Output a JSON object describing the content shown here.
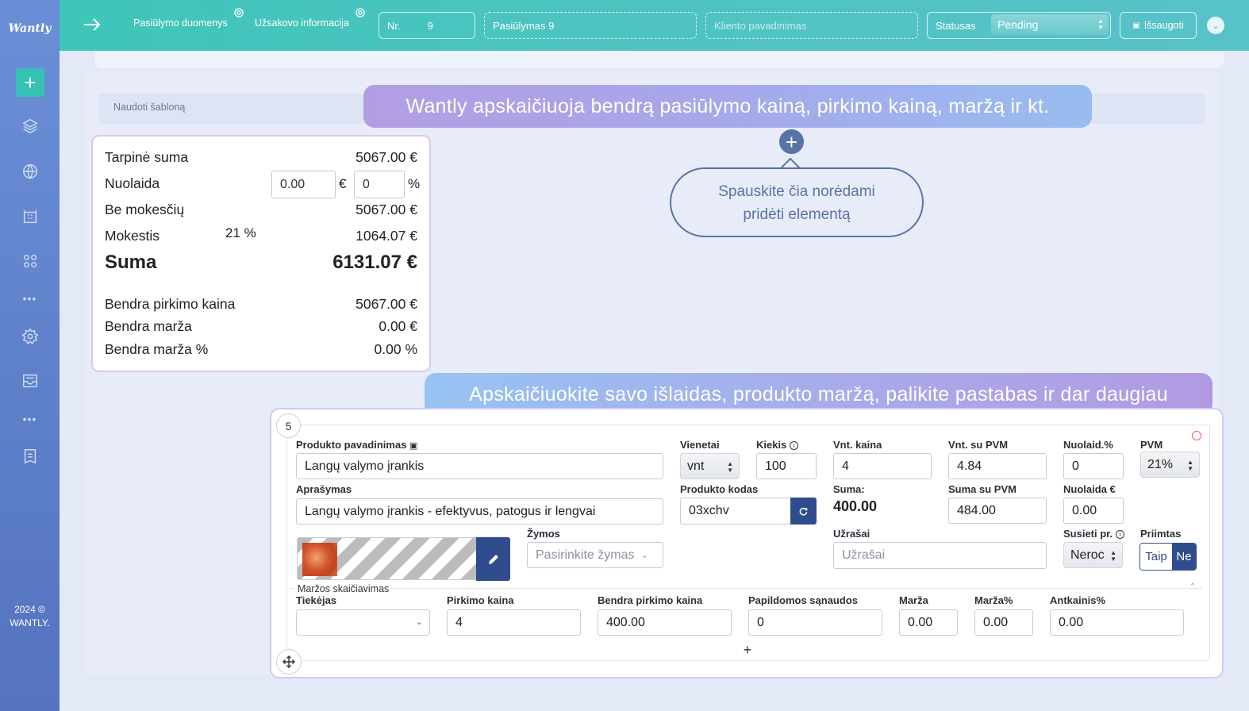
{
  "app": {
    "logo": "Wantly",
    "footer_year": "2024 ©",
    "footer_brand": "WANTLY."
  },
  "topbar": {
    "tab_offer_data": "Pasiūlymo duomenys",
    "tab_client_info": "Užsakovo informacija",
    "nr_label": "Nr.",
    "nr_value": "9",
    "offer_title": "Pasiūlymas 9",
    "client_placeholder": "Kliento pavadinimas",
    "status_label": "Statusas",
    "status_value": "Pending",
    "save_label": "Išsaugoti"
  },
  "main": {
    "use_template": "Naudoti šabloną",
    "callout_top": "Wantly apskaičiuoja bendrą pasiūlymo kainą, pirkimo kainą, maržą ir kt.",
    "callout_bottom": "Apskaičiuokite savo išlaidas, produkto maržą, palikite pastabas ir dar daugiau",
    "add_hint_line1": "Spauskite čia norėdami",
    "add_hint_line2": "pridėti elementą"
  },
  "totals": {
    "subtotal_label": "Tarpinė suma",
    "subtotal_value": "5067.00 €",
    "discount_label": "Nuolaida",
    "discount_amount": "0.00",
    "discount_currency": "€",
    "discount_percent": "0",
    "discount_percent_unit": "%",
    "no_tax_label": "Be mokesčių",
    "no_tax_value": "5067.00 €",
    "tax_label": "Mokestis",
    "tax_rate": "21 %",
    "tax_value": "1064.07 €",
    "total_label": "Suma",
    "total_value": "6131.07 €",
    "purchase_label": "Bendra pirkimo kaina",
    "purchase_value": "5067.00 €",
    "margin_label": "Bendra marža",
    "margin_value": "0.00 €",
    "margin_pct_label": "Bendra marža %",
    "margin_pct_value": "0.00 %"
  },
  "item": {
    "index": "5",
    "name_label": "Produkto pavadinimas",
    "name_value": "Langų valymo įrankis",
    "units_label": "Vienetai",
    "units_value": "vnt",
    "qty_label": "Kiekis",
    "qty_value": "100",
    "unit_price_label": "Vnt. kaina",
    "unit_price_value": "4",
    "unit_vat_label": "Vnt. su PVM",
    "unit_vat_value": "4.84",
    "discount_pct_label": "Nuolaid.%",
    "discount_pct_value": "0",
    "vat_label": "PVM",
    "vat_value": "21%",
    "desc_label": "Aprašymas",
    "desc_value": "Langų valymo įrankis - efektyvus, patogus ir lengvai",
    "code_label": "Produkto kodas",
    "code_value": "03xchv",
    "sum_label": "Suma:",
    "sum_value": "400.00",
    "sum_vat_label": "Suma su PVM",
    "sum_vat_value": "484.00",
    "discount_eur_label": "Nuolaida €",
    "discount_eur_value": "0.00",
    "tags_label": "Žymos",
    "tags_placeholder": "Pasirinkite žymas",
    "notes_label": "Užrašai",
    "notes_placeholder": "Užrašai",
    "linked_label": "Susieti pr.",
    "linked_value": "Neroc",
    "accepted_label": "Priimtas",
    "accepted_yes": "Taip",
    "accepted_no": "Ne",
    "margin_section": "Maržos skaičiavimas",
    "supplier_label": "Tiekėjas",
    "purchase_price_label": "Pirkimo kaina",
    "purchase_price_value": "4",
    "total_purchase_label": "Bendra pirkimo kaina",
    "total_purchase_value": "400.00",
    "extra_costs_label": "Papildomos sąnaudos",
    "extra_costs_value": "0",
    "margin_label": "Marža",
    "margin_value": "0.00",
    "margin_pct_label": "Marža%",
    "margin_pct_value": "0.00",
    "markup_label": "Antkainis%",
    "markup_value": "0.00"
  }
}
